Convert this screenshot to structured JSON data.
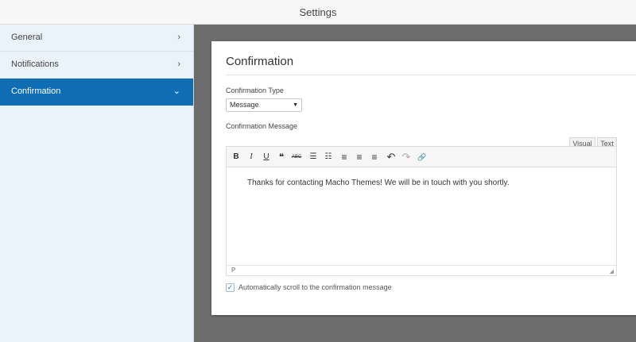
{
  "window": {
    "title": "Settings"
  },
  "sidebar": {
    "items": [
      {
        "label": "General",
        "chevron": "›"
      },
      {
        "label": "Notifications",
        "chevron": "›"
      },
      {
        "label": "Confirmation",
        "chevron": "⌄"
      }
    ],
    "active_item": "Confirmation",
    "active_color": "#0f6eb3"
  },
  "panel": {
    "title": "Confirmation",
    "confirmation_type": {
      "label": "Confirmation Type",
      "value": "Message",
      "arrow": "▼"
    },
    "confirmation_message": {
      "label": "Confirmation Message",
      "tabs": {
        "visual": "Visual",
        "text": "Text"
      },
      "toolbar": {
        "bold": "B",
        "italic": "I",
        "underline": "U",
        "blockquote": "❝",
        "strikethrough": "ABC",
        "bullet_list": "☰",
        "numbered_list": "☷",
        "align_left": "≡",
        "align_center": "≡",
        "align_right": "≡",
        "undo": "↶",
        "redo": "↷",
        "link": "🔗"
      },
      "content": "Thanks for contacting Macho Themes! We will be in touch with you shortly.",
      "status_path": "P",
      "resize_grip": "◢"
    },
    "auto_scroll": {
      "checked": true,
      "check_mark": "✓",
      "label": "Automatically scroll to the confirmation message"
    }
  }
}
